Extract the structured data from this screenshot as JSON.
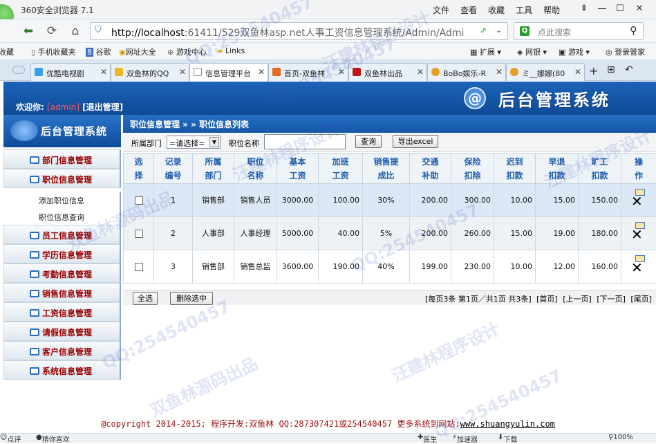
{
  "browser": {
    "title": "360安全浏览器 7.1",
    "menus": [
      "文件",
      "查看",
      "收藏",
      "工具",
      "帮助"
    ],
    "url_host": "http://localhost",
    "url_rest": ":61411/529双鱼林asp.net人事工资信息管理系统/Admin/Admi",
    "search_placeholder": "点此搜索",
    "favorites": [
      "收藏",
      "手机收藏夹",
      "谷歌",
      "网址大全",
      "游戏中心",
      "Links"
    ],
    "fav_right": [
      "扩展",
      "网银",
      "游戏",
      "登录管家"
    ],
    "tabs": [
      {
        "label": "优酷电视剧",
        "color": "#39a0e8"
      },
      {
        "label": "双鱼林的QQ",
        "color": "#e8b920"
      },
      {
        "label": "信息管理平台",
        "color": "#ffffff"
      },
      {
        "label": "首页-双鱼林",
        "color": "#e86a20"
      },
      {
        "label": "双鱼林出品",
        "color": "#c01818"
      },
      {
        "label": "BoBo娱乐-R",
        "color": "#e8a020"
      },
      {
        "label": "ミ__娜娜(80",
        "color": "#e8a020"
      }
    ]
  },
  "header": {
    "welcome_label": "欢迎你:",
    "user": "[admin]",
    "logout": "[退出管理]",
    "system_title": "后台管理系统",
    "sidebar_title": "后台管理系统"
  },
  "sidebar": {
    "items": [
      "部门信息管理",
      "职位信息管理",
      "员工信息管理",
      "学历信息管理",
      "考勤信息管理",
      "销售信息管理",
      "工资信息管理",
      "请假信息管理",
      "客户信息管理",
      "系统信息管理"
    ],
    "subitems": [
      "添加职位信息",
      "职位信息查询"
    ]
  },
  "main": {
    "breadcrumb": "职位信息管理 » » 职位信息列表",
    "filter": {
      "dept_label": "所属部门",
      "dept_value": "=请选择=",
      "name_label": "职位名称",
      "name_value": "",
      "query_button": "查询",
      "export_button": "导出excel"
    },
    "columns": [
      [
        "选",
        "择"
      ],
      [
        "记录",
        "编号"
      ],
      [
        "所属",
        "部门"
      ],
      [
        "职位",
        "名称"
      ],
      [
        "基本",
        "工资"
      ],
      [
        "加班",
        "工资"
      ],
      [
        "销售提",
        "成比"
      ],
      [
        "交通",
        "补助"
      ],
      [
        "保险",
        "扣除"
      ],
      [
        "迟到",
        "扣款"
      ],
      [
        "早退",
        "扣款"
      ],
      [
        "旷工",
        "扣款"
      ],
      [
        "操",
        "作"
      ]
    ],
    "rows": [
      {
        "id": "1",
        "dept": "销售部",
        "name": "销售人员",
        "base": "3000.00",
        "overtime": "100.00",
        "ratio": "30%",
        "traffic": "200.00",
        "insurance": "300.00",
        "late": "10.00",
        "early": "15.00",
        "absent": "150.00"
      },
      {
        "id": "2",
        "dept": "人事部",
        "name": "人事经理",
        "base": "5000.00",
        "overtime": "40.00",
        "ratio": "5%",
        "traffic": "200.00",
        "insurance": "260.00",
        "late": "15.00",
        "early": "19.00",
        "absent": "180.00"
      },
      {
        "id": "3",
        "dept": "销售部",
        "name": "销售总监",
        "base": "3600.00",
        "overtime": "190.00",
        "ratio": "40%",
        "traffic": "199.00",
        "insurance": "230.00",
        "late": "10.00",
        "early": "12.00",
        "absent": "160.00"
      }
    ],
    "select_all": "全选",
    "delete_selected": "删除选中",
    "pager": {
      "info": "[每页3条 第1页／共1页 共3条]",
      "first": "[首页]",
      "prev": "[上一页]",
      "next": "[下一页]",
      "last": "[尾页]"
    }
  },
  "footer": {
    "copyright": "@copyright 2014-2015; 程序开发:双鱼林  QQ:287307421或254540457  更多系统到网站:",
    "site": "www.shuangyulin.com"
  },
  "statusbar": {
    "left": [
      "点评",
      "猜你喜欢"
    ],
    "right": [
      "医生",
      "加速器",
      "下载",
      "100%"
    ]
  },
  "watermarks": [
    "QQ:254540457",
    "汪建林程序设计",
    "双鱼林源码出品"
  ]
}
